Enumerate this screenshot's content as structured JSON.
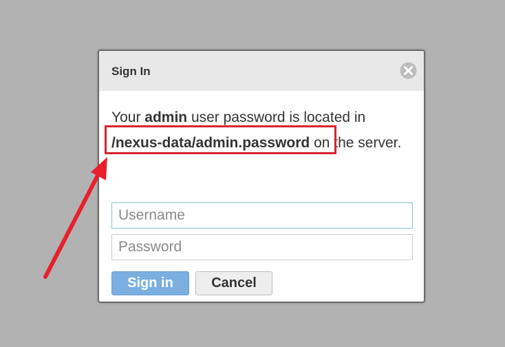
{
  "dialog": {
    "title": "Sign In",
    "close_icon": "close-circle-icon",
    "message": {
      "part1": "Your ",
      "bold1": "admin",
      "part2": " user password is located in ",
      "path": "/nexus-data/admin.password",
      "part3": " on the server."
    },
    "username_placeholder": "Username",
    "password_placeholder": "Password",
    "signin_label": "Sign in",
    "cancel_label": "Cancel"
  },
  "annotation": {
    "highlight_color": "#d9232f",
    "arrow_color": "#e8202c"
  },
  "colors": {
    "backdrop": "#b2b2b2",
    "header": "#e8e8e8",
    "primary_button": "#7aafe0"
  }
}
